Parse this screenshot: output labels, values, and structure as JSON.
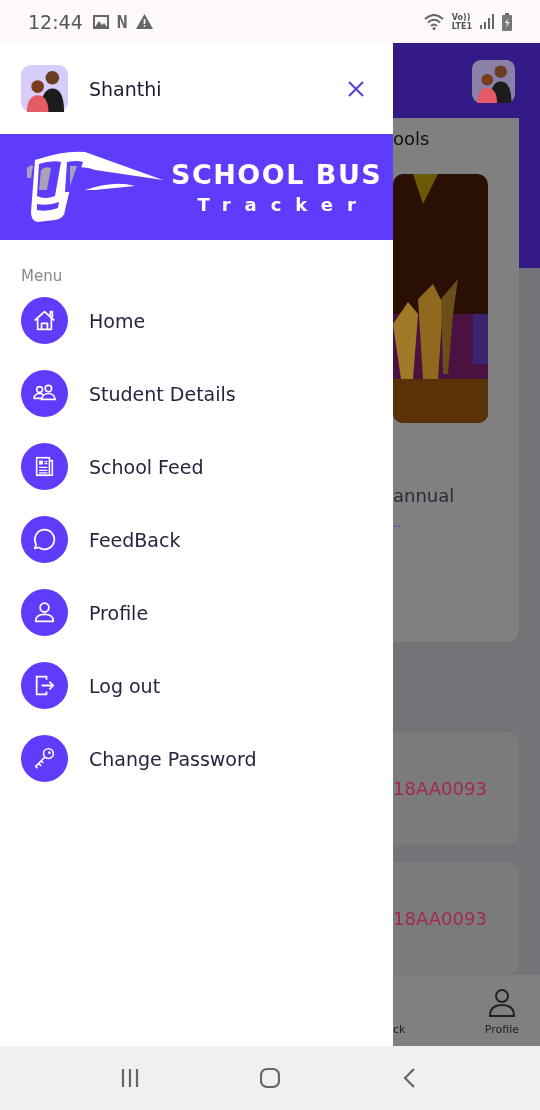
{
  "status_bar": {
    "time": "12:44",
    "notification_glyph": "N",
    "network_labels": [
      "Vo))",
      "LTE1"
    ]
  },
  "drawer": {
    "user_name": "Shanthi",
    "logo": {
      "title": "SCHOOL BUS",
      "subtitle": "Tracker"
    },
    "section_label": "Menu",
    "items": [
      {
        "label": "Home"
      },
      {
        "label": "Student Details"
      },
      {
        "label": "School Feed"
      },
      {
        "label": "FeedBack"
      },
      {
        "label": "Profile"
      },
      {
        "label": "Log out"
      },
      {
        "label": "Change Password"
      }
    ]
  },
  "background_screen": {
    "card_title": "ools",
    "feed_text": "annual",
    "feed_link": "..",
    "vehicle_cards": [
      {
        "number": "18AA0093"
      },
      {
        "number": "18AA0093"
      }
    ],
    "bottom_nav": [
      {
        "label": "ck"
      },
      {
        "label": "Profile"
      }
    ]
  }
}
